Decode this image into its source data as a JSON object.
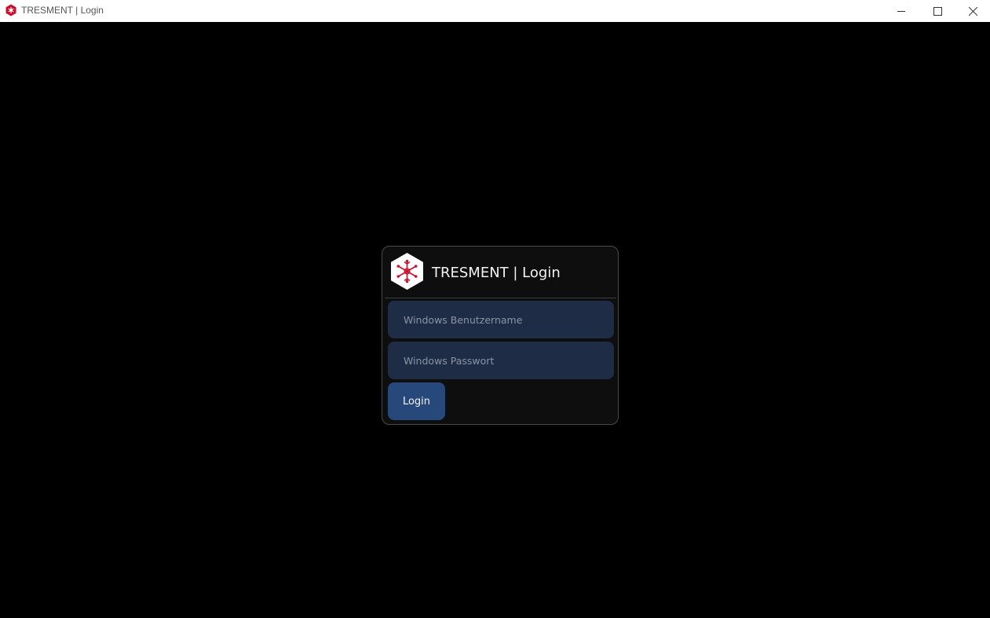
{
  "window": {
    "title": "TRESMENT | Login",
    "icon": "tresment-logo-icon",
    "controls": {
      "minimize_icon": "minimize-icon",
      "maximize_icon": "maximize-icon",
      "close_icon": "close-icon"
    }
  },
  "login": {
    "logo_icon": "tresment-logo-icon",
    "title": "TRESMENT | Login",
    "username": {
      "value": "",
      "placeholder": "Windows Benutzername"
    },
    "password": {
      "value": "",
      "placeholder": "Windows Passwort"
    },
    "submit_label": "Login"
  },
  "colors": {
    "background": "#000000",
    "card_background": "#0e0e0f",
    "input_background": "#1e2c45",
    "button_background": "#27487a",
    "brand_red": "#c8102e"
  }
}
